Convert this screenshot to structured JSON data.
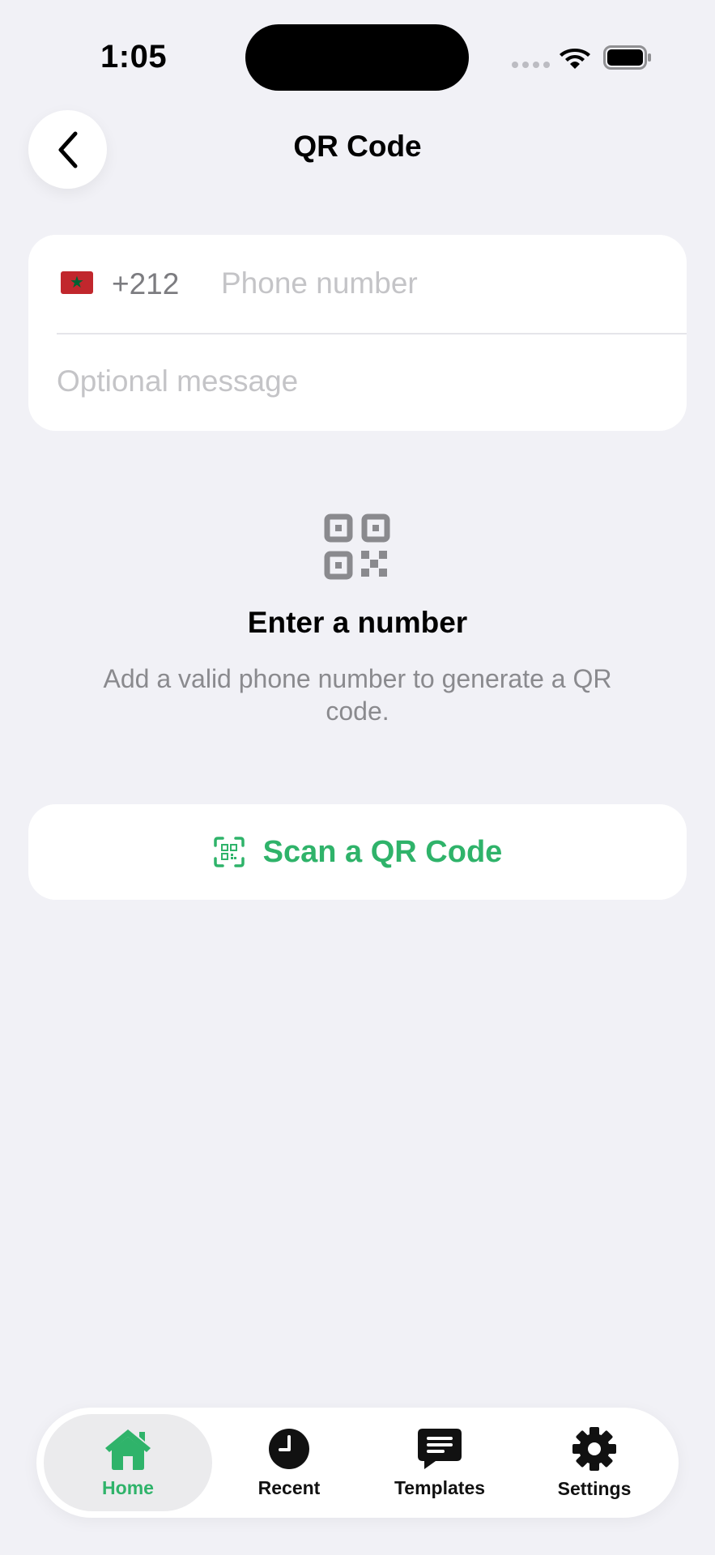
{
  "status_bar": {
    "time": "1:05"
  },
  "header": {
    "title": "QR Code",
    "back_icon": "chevron-left-icon"
  },
  "form": {
    "country_flag": "Morocco",
    "dial_code": "+212",
    "phone_value": "",
    "phone_placeholder": "Phone number",
    "message_value": "",
    "message_placeholder": "Optional message"
  },
  "empty_state": {
    "icon": "qr-code-icon",
    "title": "Enter a number",
    "description": "Add a valid phone number to generate a QR code."
  },
  "scan_button": {
    "label": "Scan a QR Code",
    "icon": "qr-scan-icon"
  },
  "tab_bar": {
    "tabs": [
      {
        "label": "Home",
        "icon": "home-icon",
        "active": true
      },
      {
        "label": "Recent",
        "icon": "clock-icon",
        "active": false
      },
      {
        "label": "Templates",
        "icon": "message-icon",
        "active": false
      },
      {
        "label": "Settings",
        "icon": "gear-icon",
        "active": false
      }
    ]
  },
  "colors": {
    "accent": "#2fb36a",
    "background": "#f1f1f6",
    "card": "#ffffff",
    "placeholder": "#c4c4c7"
  }
}
